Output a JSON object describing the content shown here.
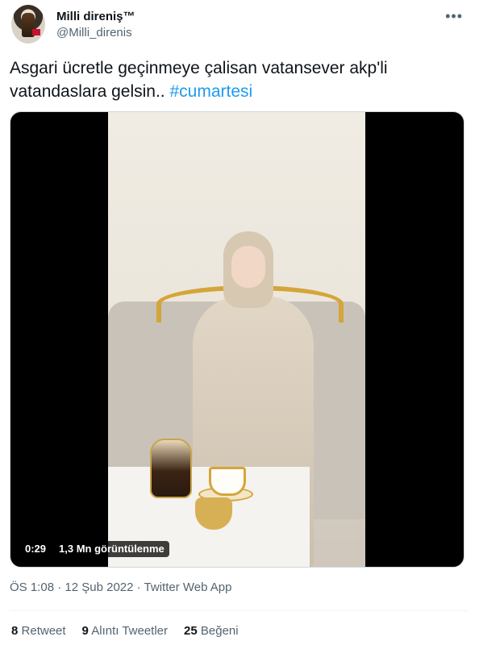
{
  "author": {
    "name": "Milli direniş™",
    "handle": "@Milli_direnis"
  },
  "more_icon": "more-horizontal-icon",
  "tweet": {
    "text": "Asgari ücretle geçinmeye çalisan vatansever akp'li vatandaslara gelsin.. ",
    "hashtag": "#cumartesi"
  },
  "video": {
    "duration": "0:29",
    "views": "1,3 Mn görüntülenme"
  },
  "meta": {
    "time": "ÖS 1:08",
    "date": "12 Şub 2022",
    "source": "Twitter Web App",
    "sep": " · "
  },
  "stats": {
    "retweet_count": "8",
    "retweet_label": "Retweet",
    "quote_count": "9",
    "quote_label": "Alıntı Tweetler",
    "like_count": "25",
    "like_label": "Beğeni"
  },
  "colors": {
    "link": "#1d9bf0",
    "secondary": "#536471"
  }
}
